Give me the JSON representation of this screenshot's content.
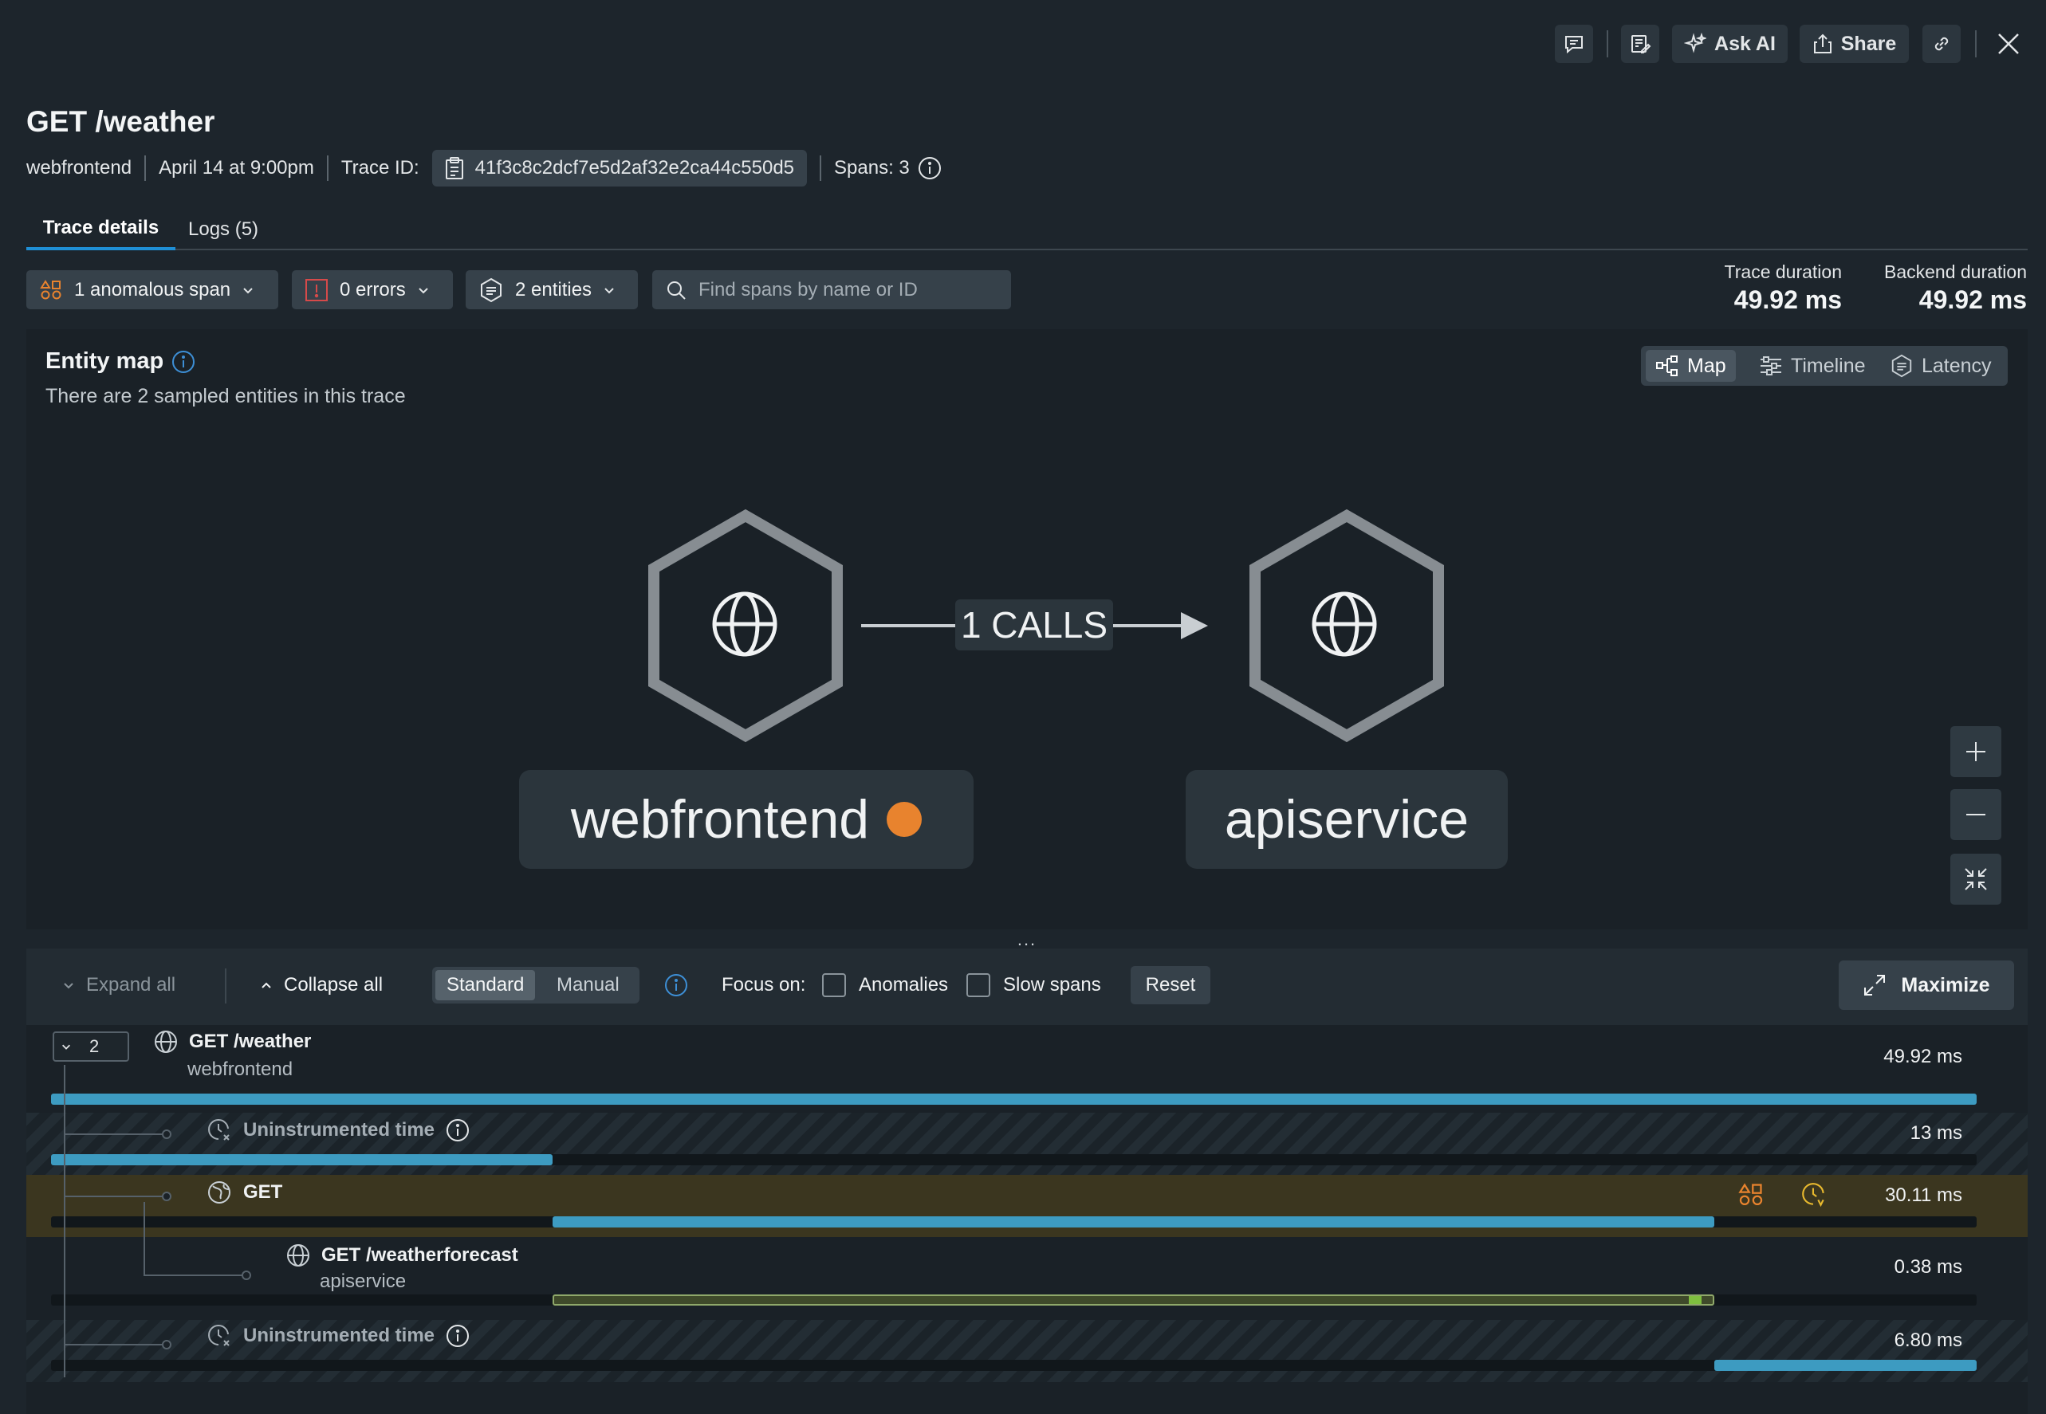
{
  "toolbar": {
    "ask_ai_label": "Ask AI",
    "share_label": "Share"
  },
  "trace": {
    "title": "GET /weather",
    "entity": "webfrontend",
    "timestamp": "April 14 at 9:00pm",
    "trace_id_label": "Trace ID:",
    "trace_id": "41f3c8c2dcf7e5d2af32e2ca44c550d5",
    "spans_label": "Spans: 3"
  },
  "tabs": [
    {
      "label": "Trace details",
      "active": true
    },
    {
      "label": "Logs (5)",
      "active": false
    }
  ],
  "filters": {
    "anomalous": "1 anomalous span",
    "errors": "0 errors",
    "entities": "2 entities",
    "search_placeholder": "Find spans by name or ID"
  },
  "durations": {
    "trace_label": "Trace duration",
    "trace_value": "49.92 ms",
    "backend_label": "Backend duration",
    "backend_value": "49.92 ms"
  },
  "entity_map": {
    "title": "Entity map",
    "subtitle": "There are 2 sampled entities in this trace",
    "views": [
      {
        "label": "Map",
        "active": true
      },
      {
        "label": "Timeline",
        "active": false
      },
      {
        "label": "Latency",
        "active": false
      }
    ],
    "source_node": "webfrontend",
    "target_node": "apiservice",
    "edge_label": "1 CALLS",
    "source_status_color": "#e8832e"
  },
  "span_toolbar": {
    "expand_all": "Expand all",
    "collapse_all": "Collapse all",
    "modes": [
      {
        "label": "Standard",
        "active": true
      },
      {
        "label": "Manual",
        "active": false
      }
    ],
    "focus_label": "Focus on:",
    "anomalies_label": "Anomalies",
    "slow_spans_label": "Slow spans",
    "reset_label": "Reset",
    "maximize_label": "Maximize",
    "dots": "..."
  },
  "spans": [
    {
      "name": "GET /weather",
      "service": "webfrontend",
      "duration": "49.92 ms",
      "children_count": "2",
      "start_frac": 0.0,
      "width_frac": 1.0
    },
    {
      "name": "Uninstrumented time",
      "service": "",
      "duration": "13 ms",
      "start_frac": 0.0,
      "width_frac": 0.2604
    },
    {
      "name": "GET",
      "service": "",
      "duration": "30.11 ms",
      "start_frac": 0.2604,
      "width_frac": 0.6032,
      "anomalous": true
    },
    {
      "name": "GET /weatherforecast",
      "service": "apiservice",
      "duration": "0.38 ms",
      "start_frac": 0.2604,
      "width_frac": 0.6032
    },
    {
      "name": "Uninstrumented time",
      "service": "",
      "duration": "6.80 ms",
      "start_frac": 0.8636,
      "width_frac": 0.1364
    }
  ],
  "colors": {
    "accent": "#1f8fd6",
    "bar": "#3d9bc1",
    "anomaly": "#e8832e",
    "highlight_row": "#3b361f"
  }
}
